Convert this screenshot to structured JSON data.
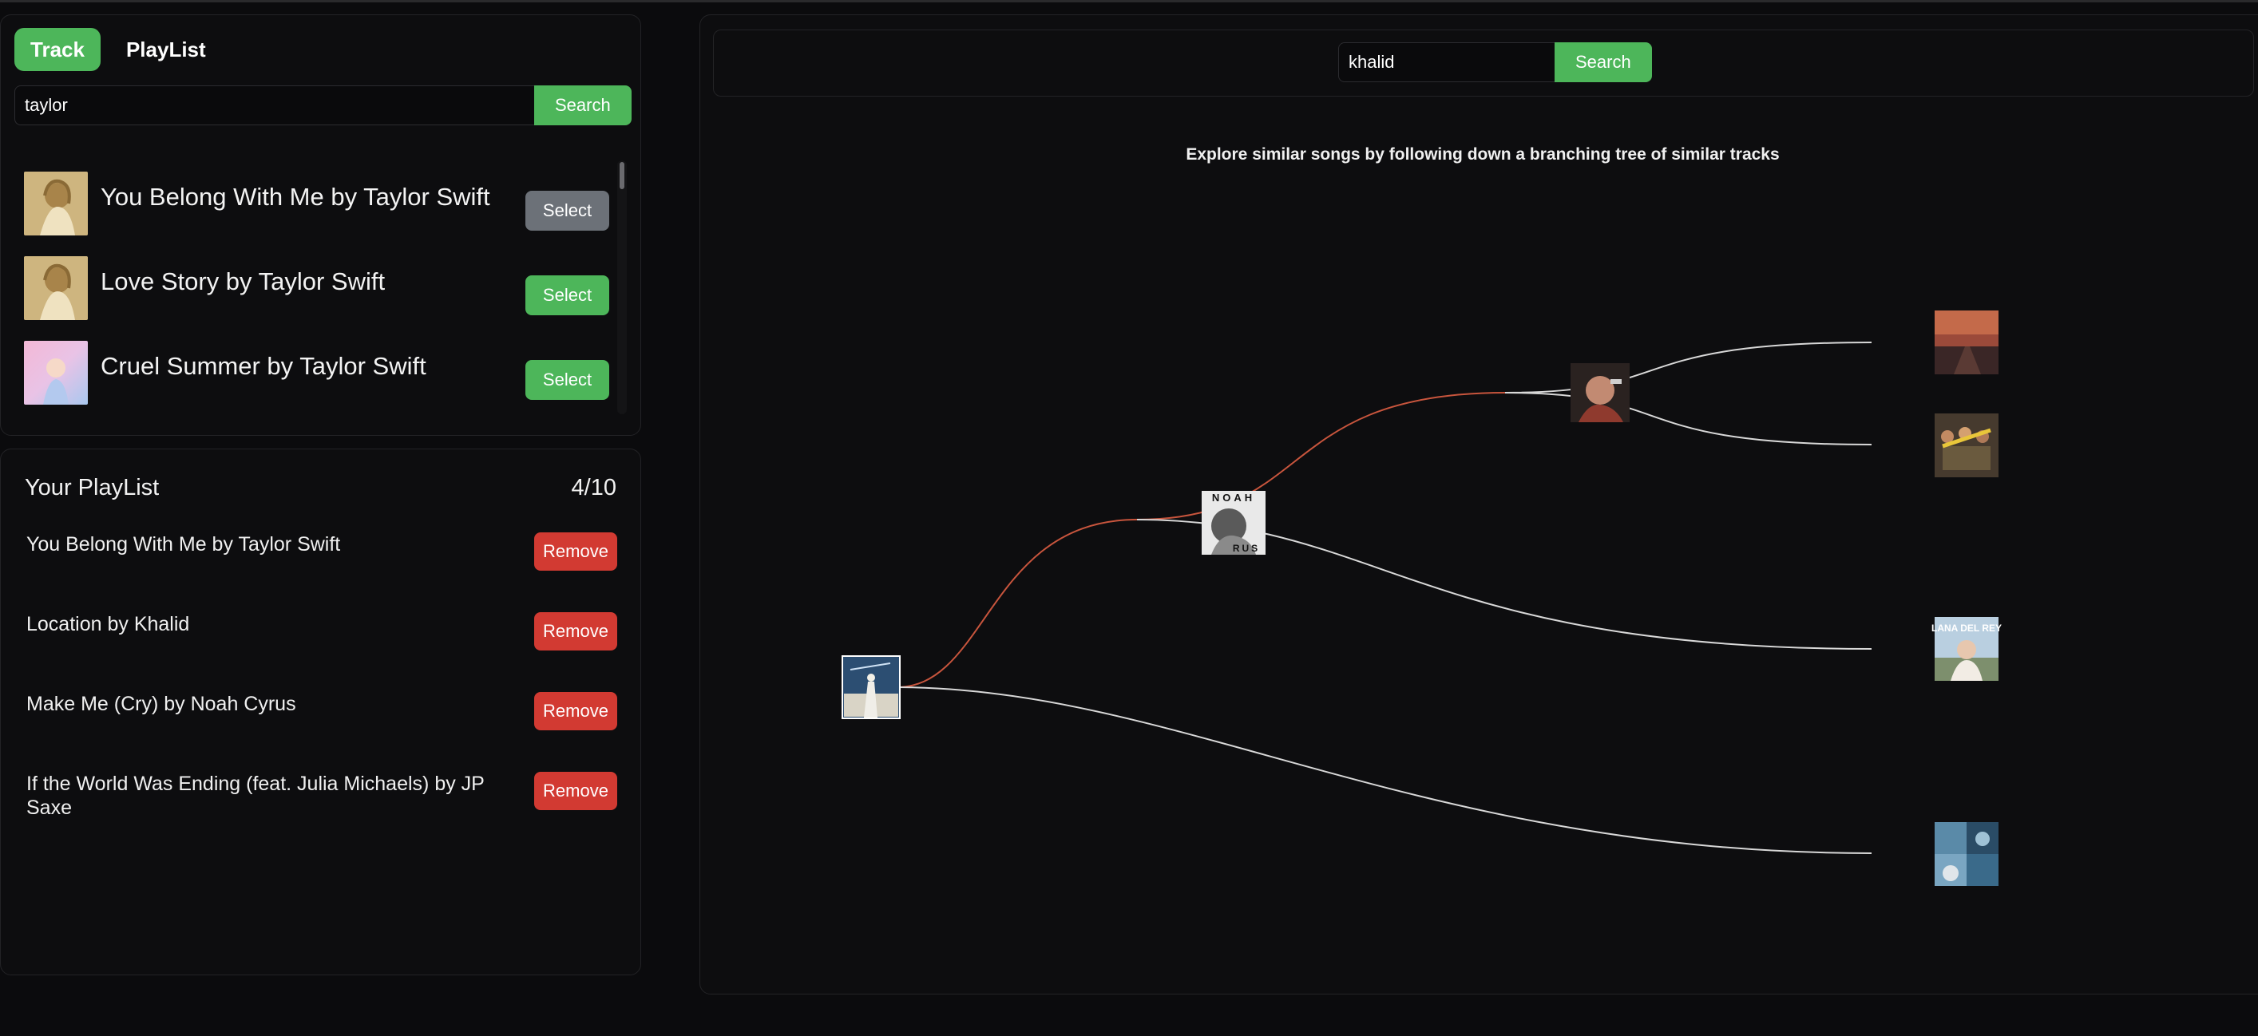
{
  "tabs": {
    "track": "Track",
    "playlist": "PlayList"
  },
  "track_search": {
    "value": "taylor",
    "button": "Search"
  },
  "results": [
    {
      "title": "You Belong With Me by Taylor Swift",
      "button": "Select",
      "button_state": "selected",
      "cover_color": "#c8b07a"
    },
    {
      "title": "Love Story by Taylor Swift",
      "button": "Select",
      "button_state": "available",
      "cover_color": "#c8b07a"
    },
    {
      "title": "Cruel Summer by Taylor Swift",
      "button": "Select",
      "button_state": "available",
      "cover_color": "#e7b3cf"
    }
  ],
  "playlist": {
    "title": "Your PlayList",
    "count": "4/10",
    "remove_label": "Remove",
    "items": [
      "You Belong With Me by Taylor Swift",
      "Location by Khalid",
      "Make Me (Cry) by Noah Cyrus",
      "If the World Was Ending (feat. Julia Michaels) by JP Saxe"
    ]
  },
  "tree": {
    "search_value": "khalid",
    "search_button": "Search",
    "caption": "Explore similar songs by following down a branching tree of similar tracks",
    "noah_cover_text": [
      "NOAH",
      "RUS"
    ],
    "lana_cover_text": "LANA DEL REY"
  },
  "colors": {
    "accent_green": "#4db65a",
    "remove_red": "#d23a32",
    "selected_gray": "#6c7178",
    "active_path": "#c8553d",
    "inactive_path": "#d8d8d8"
  }
}
